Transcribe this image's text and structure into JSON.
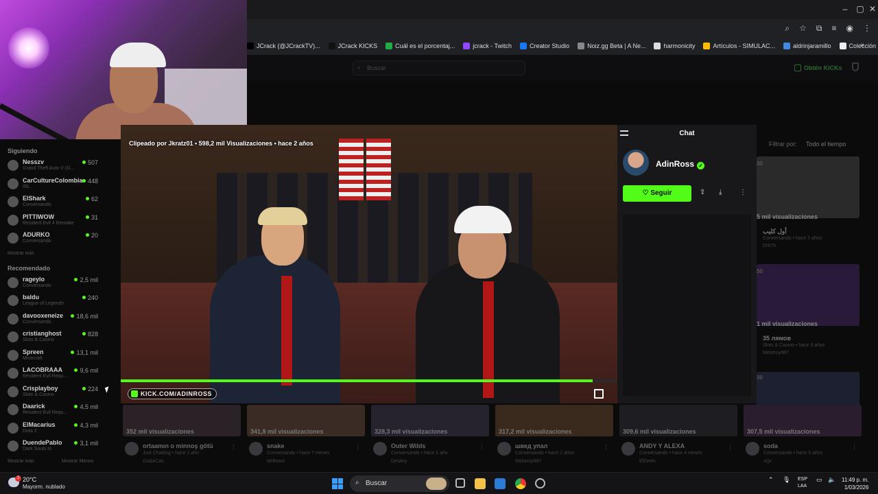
{
  "browser": {
    "bookmarks": [
      {
        "label": "JCrack (@JCrackTV)...",
        "icon": "x-icon",
        "color": "#000000"
      },
      {
        "label": "JCrack KICKS",
        "icon": "kick-icon",
        "color": "#111111"
      },
      {
        "label": "Cuál es el porcentaj...",
        "icon": "doc-icon",
        "color": "#22aa44"
      },
      {
        "label": "jcrack - Twitch",
        "icon": "twitch-icon",
        "color": "#9146ff"
      },
      {
        "label": "Creator Studio",
        "icon": "facebook-icon",
        "color": "#1877f2"
      },
      {
        "label": "Noiz.gg Beta | A Ne...",
        "icon": "noiz-icon",
        "color": "#888888"
      },
      {
        "label": "harmonicity",
        "icon": "harmonicity-icon",
        "color": "#dddddd"
      },
      {
        "label": "Artículos - SIMULAC...",
        "icon": "drive-icon",
        "color": "#ffbb00"
      },
      {
        "label": "aldrinjaramillo",
        "icon": "page-icon",
        "color": "#4488dd"
      },
      {
        "label": "Colección de M_blei...",
        "icon": "medium-icon",
        "color": "#eeeeee"
      }
    ]
  },
  "header": {
    "search_placeholder": "Buscar",
    "kicks_label": "Obtén KICKs"
  },
  "sidebar": {
    "following_title": "Siguiendo",
    "following": [
      {
        "name": "Nesszv",
        "category": "Grand Theft Auto V (G...",
        "count": "507"
      },
      {
        "name": "CarCultureColombia",
        "category": "IRL",
        "count": "448"
      },
      {
        "name": "ElShark",
        "category": "Conversando",
        "count": "62"
      },
      {
        "name": "PITTIWOW",
        "category": "Resident Evil 4 Remake",
        "count": "31"
      },
      {
        "name": "ADURKO",
        "category": "Conversando",
        "count": "20"
      }
    ],
    "show_more": "Mostrar más",
    "recommended_title": "Recomendado",
    "recommended": [
      {
        "name": "rageylo",
        "category": "Conversando",
        "count": "2,5 mil"
      },
      {
        "name": "baldu",
        "category": "League of Legends",
        "count": "240"
      },
      {
        "name": "davooxeneize",
        "category": "Conversando",
        "count": "18,6 mil"
      },
      {
        "name": "cristianghost",
        "category": "Slots & Casino",
        "count": "828"
      },
      {
        "name": "Spreen",
        "category": "Minecraft",
        "count": "13,1 mil"
      },
      {
        "name": "LACOBRAAA",
        "category": "Resident Evil Requ...",
        "count": "9,6 mil"
      },
      {
        "name": "Crisplayboy",
        "category": "Slots & Casino",
        "count": "224"
      },
      {
        "name": "Daarick",
        "category": "Resident Evil Requ...",
        "count": "4,5 mil"
      },
      {
        "name": "ElMacarius",
        "category": "Dota 2",
        "count": "4,3 mil"
      },
      {
        "name": "DuendePablo",
        "category": "Dark Souls III",
        "count": "3,1 mil"
      }
    ],
    "show_more2": "Mostrar más",
    "show_less": "Mostrar Menos"
  },
  "player": {
    "clip_info": "Clipeado por Jkratz01 • 598,2 mil Visualizaciones • hace 2 años",
    "watermark": "KICK.COM/ADINROSS",
    "progress": 0.95
  },
  "chat": {
    "title": "Chat",
    "channel": "AdinRoss",
    "follow_label": "Seguir"
  },
  "right_grid": {
    "filter_label": "Filtrar por:",
    "filter_value": "Todo el tiempo",
    "cards": [
      {
        "dur": "30",
        "views": "5 mil visualizaciones",
        "title": "أول كليب",
        "sub": "Conversando • hace 3 años",
        "author": "Drb7h"
      },
      {
        "dur": "50",
        "views": "1 mil visualizaciones",
        "title": "35 лямов",
        "sub": "Slots & Casino • hace 3 años",
        "author": "Melstroy987"
      },
      {
        "dur": "30",
        "views": "",
        "title": "",
        "sub": "",
        "author": ""
      }
    ]
  },
  "bottom_clips": [
    {
      "views": "352 mil visualizaciones",
      "title": "ortaamın o minnoş götü",
      "sub": "Just Chatting • hace 1 año",
      "author": "GulseCan"
    },
    {
      "views": "341,8 mil visualizaciones",
      "title": "snake",
      "sub": "Conversando • hace 7 meses",
      "author": "MrBeast"
    },
    {
      "views": "328,3 mil visualizaciones",
      "title": "Outer Wilds",
      "sub": "Conversando • hace 1 año",
      "author": "Destiny"
    },
    {
      "views": "317,2 mil visualizaciones",
      "title": "швед упал",
      "sub": "Conversando • hace 2 años",
      "author": "Melstroy987"
    },
    {
      "views": "309,6 mil visualizaciones",
      "title": "ANDY Y ALEXA",
      "sub": "Conversando • hace 4 meses",
      "author": "ElZeein"
    },
    {
      "views": "307,5 mil visualizaciones",
      "title": "soda",
      "sub": "Conversando • hace 3 años",
      "author": "xQc"
    }
  ],
  "taskbar": {
    "temp": "20°C",
    "condition": "Mayorm. nublado",
    "weather_badge": "2",
    "search": "Buscar",
    "lang": "ESP",
    "region": "LAA",
    "time": "11:49 p. m.",
    "date": "1/03/2026"
  }
}
